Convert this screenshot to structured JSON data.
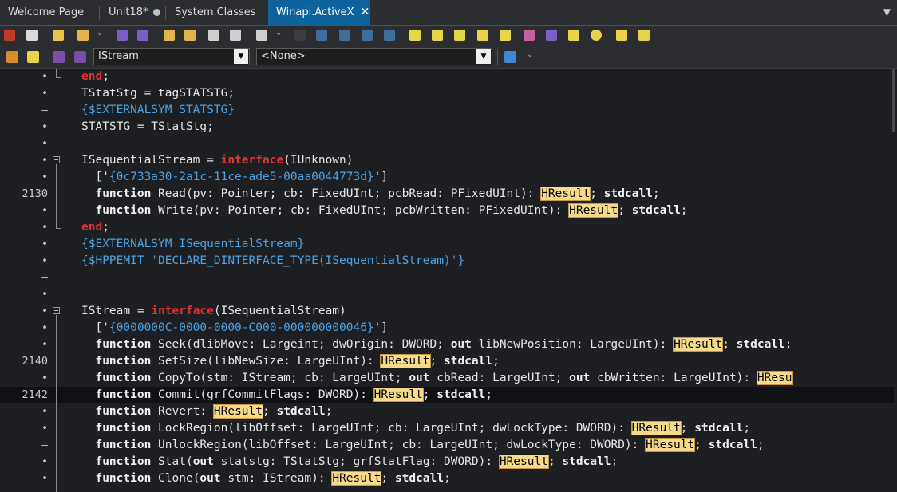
{
  "tabs": [
    {
      "label": "Welcome Page"
    },
    {
      "label": "Unit18*"
    },
    {
      "label": "System.Classes"
    },
    {
      "label": "Winapi.ActiveX"
    }
  ],
  "nav": {
    "interface_combo": "IStream",
    "method_combo": "<None>"
  },
  "colors": {
    "accent": "#0e639c",
    "highlight": "#f6d98a",
    "keyword_red": "#e23131",
    "directive": "#4aa3e6"
  },
  "code_lines": [
    {
      "gutter": "•",
      "tokens": [
        [
          "kw-red",
          "end"
        ],
        [
          "",
          "; "
        ]
      ]
    },
    {
      "gutter": "•",
      "tokens": [
        [
          "",
          "TStatStg = tagSTATSTG;"
        ]
      ]
    },
    {
      "gutter": "–",
      "tokens": [
        [
          "dir",
          "{$EXTERNALSYM STATSTG}"
        ]
      ]
    },
    {
      "gutter": "•",
      "tokens": [
        [
          "",
          "STATSTG = TStatStg;"
        ]
      ]
    },
    {
      "gutter": "•",
      "tokens": []
    },
    {
      "gutter": "•",
      "tokens": [
        [
          "",
          "ISequentialStream = "
        ],
        [
          "kw-red",
          "interface"
        ],
        [
          "",
          "(IUnknown)"
        ]
      ]
    },
    {
      "gutter": "•",
      "tokens": [
        [
          "",
          "  ['"
        ],
        [
          "str",
          "{0c733a30-2a1c-11ce-ade5-00aa0044773d}"
        ],
        [
          "",
          "']"
        ]
      ]
    },
    {
      "gutter": "2130",
      "tokens": [
        [
          "",
          "  "
        ],
        [
          "kw",
          "function"
        ],
        [
          "",
          " Read(pv: Pointer; cb: FixedUInt; pcbRead: PFixedUInt): "
        ],
        [
          "hl",
          "HResult"
        ],
        [
          "",
          "; "
        ],
        [
          "kw",
          "stdcall"
        ],
        [
          "",
          ";"
        ]
      ]
    },
    {
      "gutter": "•",
      "tokens": [
        [
          "",
          "  "
        ],
        [
          "kw",
          "function"
        ],
        [
          "",
          " Write(pv: Pointer; cb: FixedUInt; pcbWritten: PFixedUInt): "
        ],
        [
          "hl",
          "HResult"
        ],
        [
          "",
          "; "
        ],
        [
          "kw",
          "stdcall"
        ],
        [
          "",
          ";"
        ]
      ]
    },
    {
      "gutter": "•",
      "tokens": [
        [
          "kw-red",
          "end"
        ],
        [
          "",
          ";"
        ]
      ]
    },
    {
      "gutter": "•",
      "tokens": [
        [
          "dir",
          "{$EXTERNALSYM ISequentialStream}"
        ]
      ]
    },
    {
      "gutter": "•",
      "tokens": [
        [
          "dir",
          "{$HPPEMIT 'DECLARE_DINTERFACE_TYPE(ISequentialStream)'}"
        ]
      ]
    },
    {
      "gutter": "–",
      "tokens": []
    },
    {
      "gutter": "•",
      "tokens": []
    },
    {
      "gutter": "•",
      "tokens": [
        [
          "",
          "IStream = "
        ],
        [
          "kw-red",
          "interface"
        ],
        [
          "",
          "(ISequentialStream)"
        ]
      ]
    },
    {
      "gutter": "•",
      "tokens": [
        [
          "",
          "  ['"
        ],
        [
          "str",
          "{0000000C-0000-0000-C000-000000000046}"
        ],
        [
          "",
          "']"
        ]
      ]
    },
    {
      "gutter": "•",
      "tokens": [
        [
          "",
          "  "
        ],
        [
          "kw",
          "function"
        ],
        [
          "",
          " Seek(dlibMove: Largeint; dwOrigin: DWORD; "
        ],
        [
          "kw",
          "out"
        ],
        [
          "",
          " libNewPosition: LargeUInt): "
        ],
        [
          "hl",
          "HResult"
        ],
        [
          "",
          "; "
        ],
        [
          "kw",
          "stdcall"
        ],
        [
          "",
          ";"
        ]
      ]
    },
    {
      "gutter": "2140",
      "tokens": [
        [
          "",
          "  "
        ],
        [
          "kw",
          "function"
        ],
        [
          "",
          " SetSize(libNewSize: LargeUInt): "
        ],
        [
          "hl",
          "HResult"
        ],
        [
          "",
          "; "
        ],
        [
          "kw",
          "stdcall"
        ],
        [
          "",
          ";"
        ]
      ]
    },
    {
      "gutter": "•",
      "tokens": [
        [
          "",
          "  "
        ],
        [
          "kw",
          "function"
        ],
        [
          "",
          " CopyTo(stm: IStream; cb: LargeUInt; "
        ],
        [
          "kw",
          "out"
        ],
        [
          "",
          " cbRead: LargeUInt; "
        ],
        [
          "kw",
          "out"
        ],
        [
          "",
          " cbWritten: LargeUInt): "
        ],
        [
          "hl",
          "HResu"
        ]
      ]
    },
    {
      "gutter": "2142",
      "tokens": [
        [
          "",
          "  "
        ],
        [
          "kw",
          "function"
        ],
        [
          "",
          " Commit(grfCommitFlags: DWORD): "
        ],
        [
          "hl",
          "HResult"
        ],
        [
          "",
          "; "
        ],
        [
          "kw",
          "stdcall"
        ],
        [
          "",
          ";"
        ]
      ]
    },
    {
      "gutter": "•",
      "tokens": [
        [
          "",
          "  "
        ],
        [
          "kw",
          "function"
        ],
        [
          "",
          " Revert: "
        ],
        [
          "hl",
          "HResult"
        ],
        [
          "",
          "; "
        ],
        [
          "kw",
          "stdcall"
        ],
        [
          "",
          ";"
        ]
      ]
    },
    {
      "gutter": "•",
      "tokens": [
        [
          "",
          "  "
        ],
        [
          "kw",
          "function"
        ],
        [
          "",
          " LockRegion(libOffset: LargeUInt; cb: LargeUInt; dwLockType: DWORD): "
        ],
        [
          "hl",
          "HResult"
        ],
        [
          "",
          "; "
        ],
        [
          "kw",
          "stdcall"
        ],
        [
          "",
          ";"
        ]
      ]
    },
    {
      "gutter": "–",
      "tokens": [
        [
          "",
          "  "
        ],
        [
          "kw",
          "function"
        ],
        [
          "",
          " UnlockRegion(libOffset: LargeUInt; cb: LargeUInt; dwLockType: DWORD): "
        ],
        [
          "hl",
          "HResult"
        ],
        [
          "",
          "; "
        ],
        [
          "kw",
          "stdcall"
        ],
        [
          "",
          ";"
        ]
      ]
    },
    {
      "gutter": "•",
      "tokens": [
        [
          "",
          "  "
        ],
        [
          "kw",
          "function"
        ],
        [
          "",
          " Stat("
        ],
        [
          "kw",
          "out"
        ],
        [
          "",
          " statstg: TStatStg; grfStatFlag: DWORD): "
        ],
        [
          "hl",
          "HResult"
        ],
        [
          "",
          "; "
        ],
        [
          "kw",
          "stdcall"
        ],
        [
          "",
          ";"
        ]
      ]
    },
    {
      "gutter": "•",
      "tokens": [
        [
          "",
          "  "
        ],
        [
          "kw",
          "function"
        ],
        [
          "",
          " Clone("
        ],
        [
          "kw",
          "out"
        ],
        [
          "",
          " stm: IStream): "
        ],
        [
          "hl",
          "HResult"
        ],
        [
          "",
          "; "
        ],
        [
          "kw",
          "stdcall"
        ],
        [
          "",
          ";"
        ]
      ]
    }
  ]
}
